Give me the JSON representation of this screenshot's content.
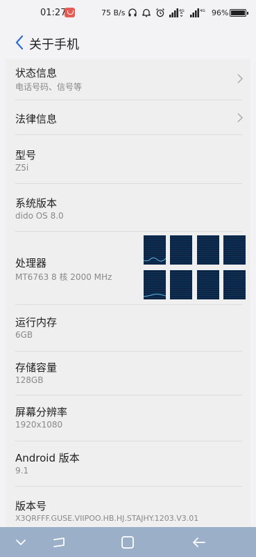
{
  "status_bar": {
    "time": "01:27",
    "net_speed": "75 B/s",
    "battery": "96%",
    "sim1_type": "4G",
    "sim2_type": "4G"
  },
  "header": {
    "title": "关于手机"
  },
  "items": [
    {
      "title": "状态信息",
      "subtitle": "电话号码、信号等"
    },
    {
      "title": "法律信息"
    },
    {
      "title": "型号",
      "subtitle": "Z5i"
    },
    {
      "title": "系统版本",
      "subtitle": "dido OS 8.0"
    },
    {
      "title": "处理器",
      "subtitle": "MT6763 8 核 2000 MHz"
    },
    {
      "title": "运行内存",
      "subtitle": "6GB"
    },
    {
      "title": "存储容量",
      "subtitle": "128GB"
    },
    {
      "title": "屏幕分辨率",
      "subtitle": "1920x1080"
    },
    {
      "title": "Android 版本",
      "subtitle": "9.1"
    },
    {
      "title": "版本号",
      "subtitle": "X3QRFFF.GUSE.VIIPOO.HB.HJ.STAJHY.1203.V3.01"
    }
  ],
  "colors": {
    "navbar": "#9bb0c8",
    "accent": "#2f6fd1",
    "cpu_bg": "#0e2a4a"
  }
}
